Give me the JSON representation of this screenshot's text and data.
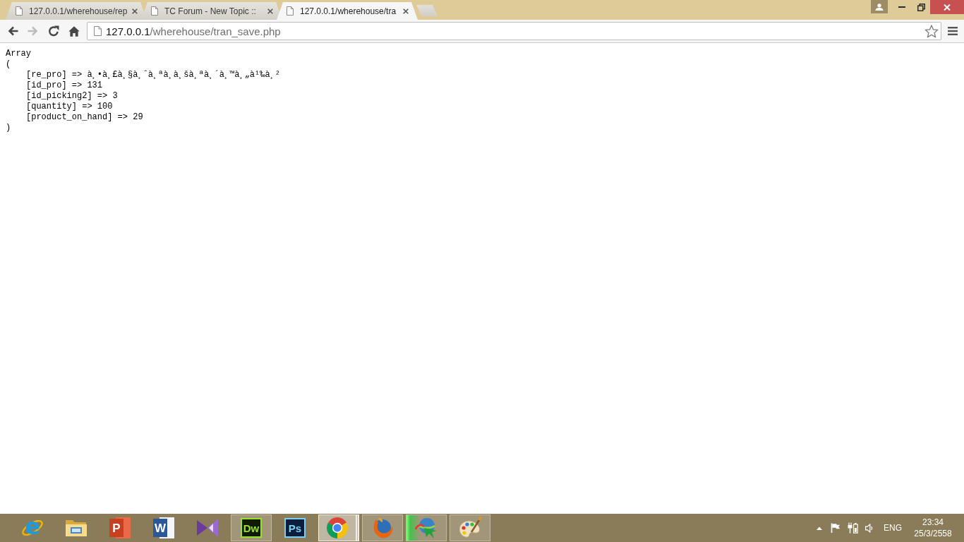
{
  "browser": {
    "tabs": [
      {
        "title": "127.0.0.1/wherehouse/rep",
        "selected": false
      },
      {
        "title": "TC Forum - New Topic ::",
        "selected": false
      },
      {
        "title": "127.0.0.1/wherehouse/tra",
        "selected": true
      }
    ],
    "nav_buttons": [
      {
        "kind": "back",
        "disabled": false
      },
      {
        "kind": "forward",
        "disabled": true
      },
      {
        "kind": "reload",
        "disabled": false
      },
      {
        "kind": "home",
        "disabled": false
      }
    ],
    "address_bar": {
      "host": "127.0.0.1",
      "path": "/wherehouse/tran_save.php"
    }
  },
  "page": {
    "type_label": "Array",
    "open": "(",
    "entries": [
      "[re_pro] => à¸•à¸£à¸§à¸ˆà¸ªà¸à¸šà¸ªà¸´à¸™à¸„à¹‰à¸²",
      "[id_pro] => 131",
      "[id_picking2] => 3",
      "[quantity] => 100",
      "[product_on_hand] => 29"
    ],
    "close": ")"
  },
  "taskbar": {
    "apps": [
      {
        "kind": "e_logo",
        "label": "e",
        "running": false,
        "active": false,
        "stacked": false
      },
      {
        "kind": "folder",
        "running": false,
        "active": false,
        "stacked": false
      },
      {
        "kind": "slides",
        "label": "P",
        "running": false,
        "active": false,
        "stacked": false
      },
      {
        "kind": "document",
        "label": "W",
        "running": false,
        "active": false,
        "stacked": false
      },
      {
        "kind": "bowtie",
        "running": false,
        "active": false,
        "stacked": false
      },
      {
        "kind": "dw_tile",
        "label": "Dw",
        "running": true,
        "active": false,
        "stacked": false
      },
      {
        "kind": "ps_tile",
        "label": "Ps",
        "running": false,
        "active": false,
        "stacked": false
      },
      {
        "kind": "tricolor",
        "running": true,
        "active": true,
        "stacked": true
      },
      {
        "kind": "fox_globe",
        "running": true,
        "active": false,
        "stacked": false
      },
      {
        "kind": "globe_arrow",
        "running": true,
        "active": false,
        "stacked": false,
        "level": 0.3
      },
      {
        "kind": "palette",
        "running": true,
        "active": false,
        "stacked": false
      }
    ],
    "tray": {
      "language": "ENG",
      "time": "23:34",
      "date": "25/3/2558"
    }
  }
}
